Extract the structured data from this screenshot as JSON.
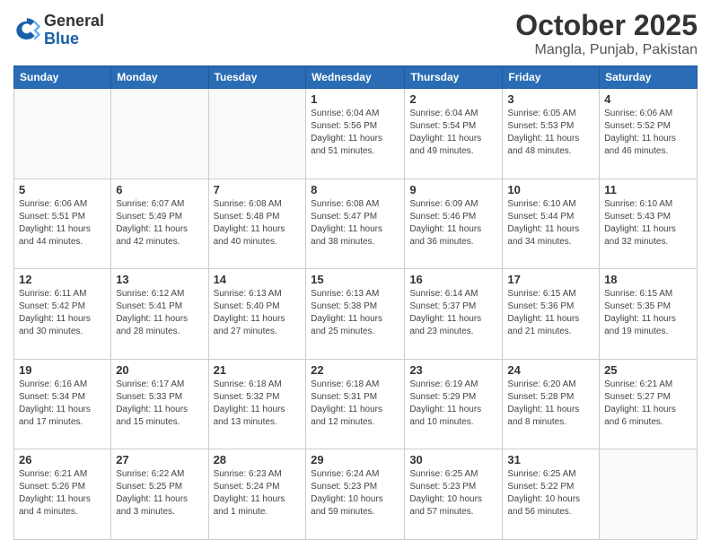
{
  "header": {
    "logo_general": "General",
    "logo_blue": "Blue",
    "title": "October 2025",
    "subtitle": "Mangla, Punjab, Pakistan"
  },
  "days_of_week": [
    "Sunday",
    "Monday",
    "Tuesday",
    "Wednesday",
    "Thursday",
    "Friday",
    "Saturday"
  ],
  "weeks": [
    [
      {
        "num": "",
        "info": ""
      },
      {
        "num": "",
        "info": ""
      },
      {
        "num": "",
        "info": ""
      },
      {
        "num": "1",
        "info": "Sunrise: 6:04 AM\nSunset: 5:56 PM\nDaylight: 11 hours\nand 51 minutes."
      },
      {
        "num": "2",
        "info": "Sunrise: 6:04 AM\nSunset: 5:54 PM\nDaylight: 11 hours\nand 49 minutes."
      },
      {
        "num": "3",
        "info": "Sunrise: 6:05 AM\nSunset: 5:53 PM\nDaylight: 11 hours\nand 48 minutes."
      },
      {
        "num": "4",
        "info": "Sunrise: 6:06 AM\nSunset: 5:52 PM\nDaylight: 11 hours\nand 46 minutes."
      }
    ],
    [
      {
        "num": "5",
        "info": "Sunrise: 6:06 AM\nSunset: 5:51 PM\nDaylight: 11 hours\nand 44 minutes."
      },
      {
        "num": "6",
        "info": "Sunrise: 6:07 AM\nSunset: 5:49 PM\nDaylight: 11 hours\nand 42 minutes."
      },
      {
        "num": "7",
        "info": "Sunrise: 6:08 AM\nSunset: 5:48 PM\nDaylight: 11 hours\nand 40 minutes."
      },
      {
        "num": "8",
        "info": "Sunrise: 6:08 AM\nSunset: 5:47 PM\nDaylight: 11 hours\nand 38 minutes."
      },
      {
        "num": "9",
        "info": "Sunrise: 6:09 AM\nSunset: 5:46 PM\nDaylight: 11 hours\nand 36 minutes."
      },
      {
        "num": "10",
        "info": "Sunrise: 6:10 AM\nSunset: 5:44 PM\nDaylight: 11 hours\nand 34 minutes."
      },
      {
        "num": "11",
        "info": "Sunrise: 6:10 AM\nSunset: 5:43 PM\nDaylight: 11 hours\nand 32 minutes."
      }
    ],
    [
      {
        "num": "12",
        "info": "Sunrise: 6:11 AM\nSunset: 5:42 PM\nDaylight: 11 hours\nand 30 minutes."
      },
      {
        "num": "13",
        "info": "Sunrise: 6:12 AM\nSunset: 5:41 PM\nDaylight: 11 hours\nand 28 minutes."
      },
      {
        "num": "14",
        "info": "Sunrise: 6:13 AM\nSunset: 5:40 PM\nDaylight: 11 hours\nand 27 minutes."
      },
      {
        "num": "15",
        "info": "Sunrise: 6:13 AM\nSunset: 5:38 PM\nDaylight: 11 hours\nand 25 minutes."
      },
      {
        "num": "16",
        "info": "Sunrise: 6:14 AM\nSunset: 5:37 PM\nDaylight: 11 hours\nand 23 minutes."
      },
      {
        "num": "17",
        "info": "Sunrise: 6:15 AM\nSunset: 5:36 PM\nDaylight: 11 hours\nand 21 minutes."
      },
      {
        "num": "18",
        "info": "Sunrise: 6:15 AM\nSunset: 5:35 PM\nDaylight: 11 hours\nand 19 minutes."
      }
    ],
    [
      {
        "num": "19",
        "info": "Sunrise: 6:16 AM\nSunset: 5:34 PM\nDaylight: 11 hours\nand 17 minutes."
      },
      {
        "num": "20",
        "info": "Sunrise: 6:17 AM\nSunset: 5:33 PM\nDaylight: 11 hours\nand 15 minutes."
      },
      {
        "num": "21",
        "info": "Sunrise: 6:18 AM\nSunset: 5:32 PM\nDaylight: 11 hours\nand 13 minutes."
      },
      {
        "num": "22",
        "info": "Sunrise: 6:18 AM\nSunset: 5:31 PM\nDaylight: 11 hours\nand 12 minutes."
      },
      {
        "num": "23",
        "info": "Sunrise: 6:19 AM\nSunset: 5:29 PM\nDaylight: 11 hours\nand 10 minutes."
      },
      {
        "num": "24",
        "info": "Sunrise: 6:20 AM\nSunset: 5:28 PM\nDaylight: 11 hours\nand 8 minutes."
      },
      {
        "num": "25",
        "info": "Sunrise: 6:21 AM\nSunset: 5:27 PM\nDaylight: 11 hours\nand 6 minutes."
      }
    ],
    [
      {
        "num": "26",
        "info": "Sunrise: 6:21 AM\nSunset: 5:26 PM\nDaylight: 11 hours\nand 4 minutes."
      },
      {
        "num": "27",
        "info": "Sunrise: 6:22 AM\nSunset: 5:25 PM\nDaylight: 11 hours\nand 3 minutes."
      },
      {
        "num": "28",
        "info": "Sunrise: 6:23 AM\nSunset: 5:24 PM\nDaylight: 11 hours\nand 1 minute."
      },
      {
        "num": "29",
        "info": "Sunrise: 6:24 AM\nSunset: 5:23 PM\nDaylight: 10 hours\nand 59 minutes."
      },
      {
        "num": "30",
        "info": "Sunrise: 6:25 AM\nSunset: 5:23 PM\nDaylight: 10 hours\nand 57 minutes."
      },
      {
        "num": "31",
        "info": "Sunrise: 6:25 AM\nSunset: 5:22 PM\nDaylight: 10 hours\nand 56 minutes."
      },
      {
        "num": "",
        "info": ""
      }
    ]
  ]
}
